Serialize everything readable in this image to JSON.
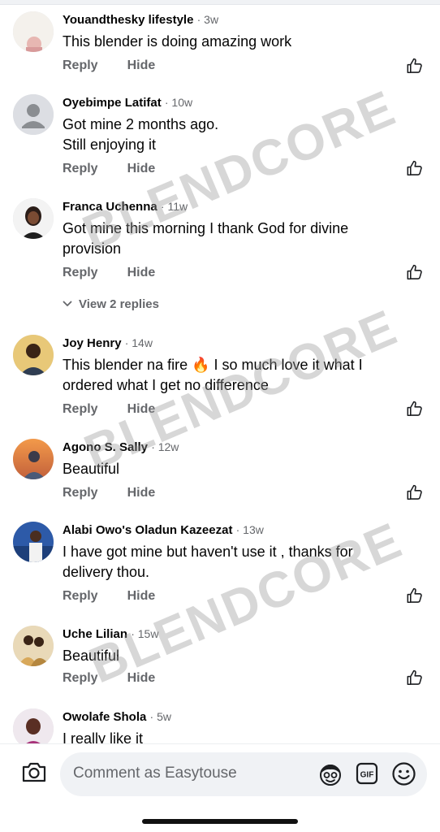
{
  "comments": [
    {
      "author": "Youandthesky lifestyle",
      "time": "· 3w",
      "text": "This blender is doing amazing work",
      "reply": "Reply",
      "hide": "Hide"
    },
    {
      "author": "Oyebimpe Latifat",
      "time": "· 10w",
      "text_lines": [
        "Got mine 2 months ago.",
        "Still enjoying it"
      ],
      "reply": "Reply",
      "hide": "Hide"
    },
    {
      "author": "Franca Uchenna",
      "time": "· 11w",
      "text": "Got mine this morning I thank God for divine provision",
      "reply": "Reply",
      "hide": "Hide",
      "view_replies": "View 2 replies"
    },
    {
      "author": "Joy Henry",
      "time": "· 14w",
      "text_before_emoji": "This blender na fire ",
      "emoji": "🔥",
      "text_after_emoji": " I so much love it what I ordered what I get no difference",
      "reply": "Reply",
      "hide": "Hide"
    },
    {
      "author": "Agono S. Sally",
      "time": "· 12w",
      "text": "Beautiful",
      "reply": "Reply",
      "hide": "Hide"
    },
    {
      "author": "Alabi Owo's Oladun Kazeezat",
      "time": "· 13w",
      "text": "I have got mine but haven't use it , thanks for delivery thou.",
      "reply": "Reply",
      "hide": "Hide"
    },
    {
      "author": "Uche Lilian",
      "time": "· 15w",
      "text": "Beautiful",
      "reply": "Reply",
      "hide": "Hide"
    },
    {
      "author": "Owolafe Shola",
      "time": "· 5w",
      "text": "I really like it"
    }
  ],
  "watermark": "BLENDCORE",
  "composer": {
    "placeholder": "Comment as Easytouse",
    "icons": [
      "camera-icon",
      "avatar-sticker-icon",
      "gif-icon",
      "emoji-icon"
    ]
  },
  "icons": {
    "like": "thumbs-up-icon",
    "chevron": "chevron-down-icon"
  },
  "colors": {
    "meta_text": "#65676b",
    "body_text": "#050505",
    "composer_bg": "#f0f2f5"
  }
}
